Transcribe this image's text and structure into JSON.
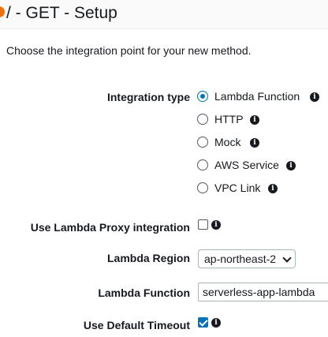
{
  "header": {
    "title": "/ - GET - Setup"
  },
  "intro": "Choose the integration point for your new method.",
  "integration": {
    "label": "Integration type",
    "selected": "Lambda Function",
    "options": [
      "Lambda Function",
      "HTTP",
      "Mock",
      "AWS Service",
      "VPC Link"
    ]
  },
  "proxy": {
    "label": "Use Lambda Proxy integration",
    "checked": false
  },
  "region": {
    "label": "Lambda Region",
    "value": "ap-northeast-2"
  },
  "function": {
    "label": "Lambda Function",
    "value": "serverless-app-lambda"
  },
  "timeout": {
    "label": "Use Default Timeout",
    "checked": true
  },
  "icons": {
    "info": "info-icon",
    "dropdown": "chevron-down-icon"
  },
  "colors": {
    "accent": "#0073bb",
    "status_dot": "#ec7211",
    "text": "#16191f"
  }
}
